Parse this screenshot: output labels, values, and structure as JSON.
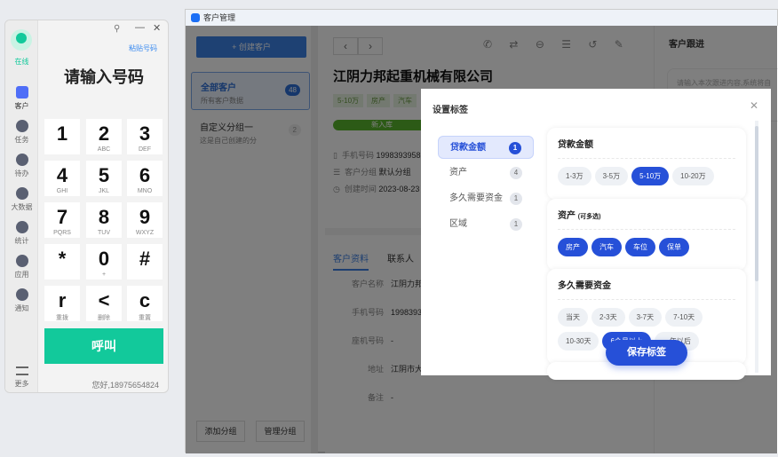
{
  "dialer": {
    "status": "在线",
    "sidebar": [
      {
        "label": "客户",
        "icon": "customers-icon"
      },
      {
        "label": "任务",
        "icon": "task-icon"
      },
      {
        "label": "待办",
        "icon": "todo-icon"
      },
      {
        "label": "大数据",
        "icon": "location-icon"
      },
      {
        "label": "统计",
        "icon": "stats-icon"
      },
      {
        "label": "应用",
        "icon": "apps-icon"
      },
      {
        "label": "通知",
        "icon": "bell-icon"
      }
    ],
    "more": "更多",
    "paste": "粘贴号码",
    "title": "请输入号码",
    "keys": [
      {
        "n": "1",
        "s": ""
      },
      {
        "n": "2",
        "s": "ABC"
      },
      {
        "n": "3",
        "s": "DEF"
      },
      {
        "n": "4",
        "s": "GHI"
      },
      {
        "n": "5",
        "s": "JKL"
      },
      {
        "n": "6",
        "s": "MNO"
      },
      {
        "n": "7",
        "s": "PQRS"
      },
      {
        "n": "8",
        "s": "TUV"
      },
      {
        "n": "9",
        "s": "WXYZ"
      },
      {
        "n": "*",
        "s": ""
      },
      {
        "n": "0",
        "s": "+"
      },
      {
        "n": "#",
        "s": ""
      },
      {
        "n": "r",
        "s": "重拨"
      },
      {
        "n": "<",
        "s": "删除"
      },
      {
        "n": "c",
        "s": "重置"
      }
    ],
    "call": "呼叫",
    "greeting": "您好,18975654824"
  },
  "main": {
    "window_title": "客户管理",
    "create": "+ 创建客户",
    "groups": [
      {
        "name": "全部客户",
        "desc": "所有客户数据",
        "count": "48"
      },
      {
        "name": "自定义分组一",
        "desc": "这是自己创建的分",
        "count": "2"
      }
    ],
    "add_group": "添加分组",
    "manage_group": "管理分组",
    "company": "江阴力邦起重机械有限公司",
    "tags": [
      "5-10万",
      "房产",
      "汽车"
    ],
    "stage": "新入库",
    "info": [
      {
        "label": "手机号码",
        "value": "1998393958"
      },
      {
        "label": "客户分组",
        "value": "默认分组"
      },
      {
        "label": "创建时间",
        "value": "2023-08-23"
      }
    ],
    "tabs": [
      "客户资料",
      "联系人"
    ],
    "fields": [
      {
        "label": "客户名称",
        "value": "江阴力邦"
      },
      {
        "label": "手机号码",
        "value": "1998393"
      },
      {
        "label": "座机号码",
        "value": "-"
      },
      {
        "label": "地址",
        "value": "江阴市大"
      },
      {
        "label": "备注",
        "value": "-"
      }
    ],
    "followup_title": "客户跟进",
    "followup_placeholder": "请输入本次跟进内容,系统将自"
  },
  "modal": {
    "title": "设置标签",
    "nav": [
      {
        "label": "贷款金额",
        "count": "1"
      },
      {
        "label": "资产",
        "count": "4"
      },
      {
        "label": "多久需要资金",
        "count": "1"
      },
      {
        "label": "区域",
        "count": "1"
      }
    ],
    "sections": [
      {
        "title": "贷款金额",
        "note": "",
        "options": [
          {
            "t": "1-3万",
            "on": false
          },
          {
            "t": "3-5万",
            "on": false
          },
          {
            "t": "5-10万",
            "on": true
          },
          {
            "t": "10-20万",
            "on": false
          }
        ]
      },
      {
        "title": "资产",
        "note": "(可多选)",
        "options": [
          {
            "t": "房产",
            "on": true
          },
          {
            "t": "汽车",
            "on": true
          },
          {
            "t": "车位",
            "on": true
          },
          {
            "t": "保单",
            "on": true
          }
        ]
      },
      {
        "title": "多久需要资金",
        "note": "",
        "options": [
          {
            "t": "当天",
            "on": false
          },
          {
            "t": "2-3天",
            "on": false
          },
          {
            "t": "3-7天",
            "on": false
          },
          {
            "t": "7-10天",
            "on": false
          },
          {
            "t": "10-30天",
            "on": false
          },
          {
            "t": "6个月以上",
            "on": true
          },
          {
            "t": "一年以后",
            "on": false
          }
        ]
      }
    ],
    "save": "保存标签"
  },
  "colors": {
    "accent": "#2650d8",
    "green": "#12c99b"
  }
}
